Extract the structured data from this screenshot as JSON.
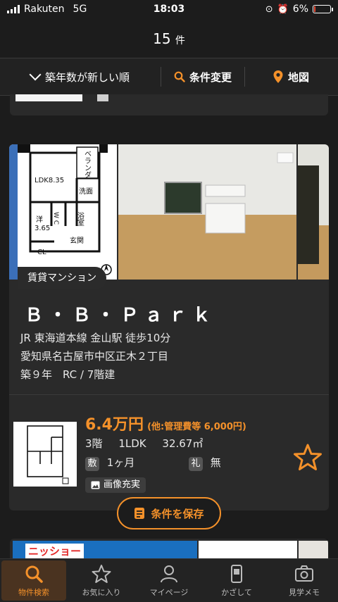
{
  "status_bar": {
    "carrier": "Rakuten",
    "network": "5G",
    "time": "18:03",
    "battery": "6%",
    "battery_level": 0.06
  },
  "header": {
    "count": "15",
    "count_unit": "件"
  },
  "filter_bar": {
    "sort_label": "築年数が新しい順",
    "conditions_label": "条件変更",
    "map_label": "地図"
  },
  "listing": {
    "type_badge": "賃貸マンション",
    "name": "Ｂ・Ｂ・Ｐａｒｋ",
    "access": "JR 東海道本線 金山駅 徒歩10分",
    "address": "愛知県名古屋市中区正木２丁目",
    "building": "築９年　RC / 7階建",
    "floorplan": {
      "ldk": "LDK8.35",
      "veranda": "ベランダ",
      "washroom": "洗面",
      "bath": "浴室",
      "wc": "W C",
      "western_room": "洋",
      "western_size": "3.65",
      "entrance": "玄関",
      "closet": "CL"
    },
    "unit": {
      "rent": "6.4万円",
      "fee": "(他:管理費等 6,000円)",
      "floor": "3階",
      "layout": "1LDK",
      "area": "32.67㎡",
      "deposit_label": "敷",
      "deposit": "1ヶ月",
      "key_money_label": "礼",
      "key_money": "無",
      "image_tag": "画像充実"
    }
  },
  "save_button": "条件を保存",
  "next_listing": {
    "banner_text": "ニッショー"
  },
  "tabs": [
    {
      "label": "物件検索",
      "icon": "search-icon",
      "active": true
    },
    {
      "label": "お気に入り",
      "icon": "star-icon",
      "active": false
    },
    {
      "label": "マイページ",
      "icon": "user-icon",
      "active": false
    },
    {
      "label": "かざして",
      "icon": "phone-scan-icon",
      "active": false
    },
    {
      "label": "見学メモ",
      "icon": "camera-icon",
      "active": false
    }
  ],
  "colors": {
    "accent": "#f4912a",
    "background": "#1c1c1c",
    "card": "#2a2a2a"
  }
}
